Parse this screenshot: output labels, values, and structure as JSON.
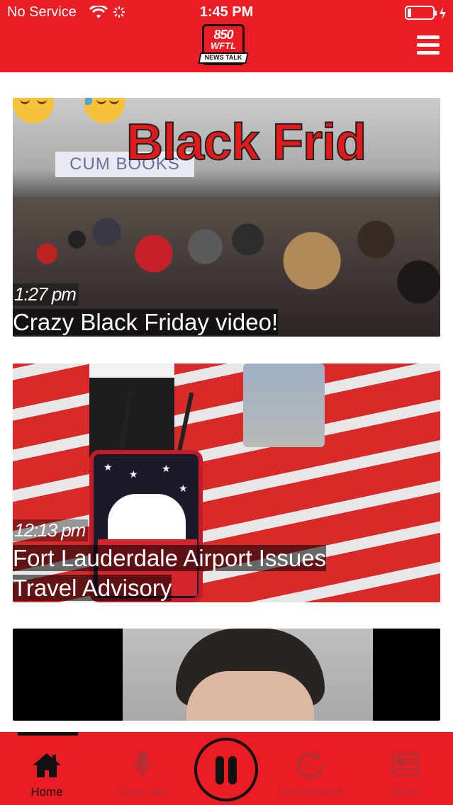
{
  "status_bar": {
    "carrier": "No Service",
    "time": "1:45 PM"
  },
  "logo": {
    "number": "850",
    "call_sign": "WFTL",
    "tagline": "NEWS TALK"
  },
  "colors": {
    "brand_red": "#ec1c24",
    "active_tab": "#111111",
    "inactive_tab": "#b03036"
  },
  "cards": [
    {
      "timestamp": "1:27 pm",
      "title": "Crazy Black Friday video!",
      "image_overlay_text": "Black Frid",
      "image_sign_text": "CUM BOOKS"
    },
    {
      "timestamp": "12:13 pm",
      "title": "Fort Lauderdale Airport Issues Travel Advisory"
    },
    {
      "timestamp": "",
      "title": ""
    }
  ],
  "tabs": [
    {
      "label": "Home",
      "icon": "home-icon",
      "active": true
    },
    {
      "label": "Open Mic",
      "icon": "microphone-icon",
      "active": false
    },
    {
      "label": "On Demand",
      "icon": "24-hour-icon",
      "active": false
    },
    {
      "label": "News",
      "icon": "newspaper-icon",
      "active": false
    }
  ],
  "player": {
    "state": "playing",
    "icon": "pause-icon"
  }
}
